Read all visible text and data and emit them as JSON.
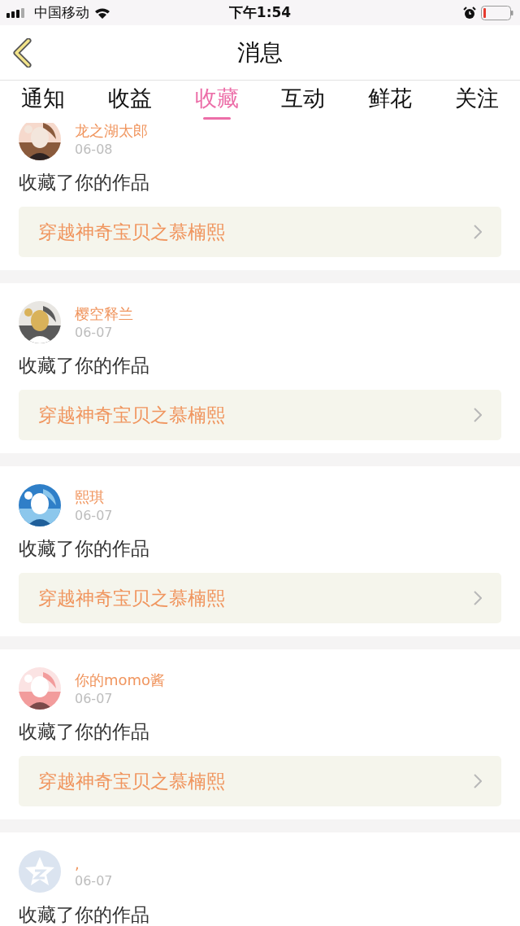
{
  "status_bar": {
    "carrier": "中国移动",
    "time": "下午1:54"
  },
  "nav": {
    "title": "消息"
  },
  "tabs": [
    {
      "label": "通知",
      "selected": false
    },
    {
      "label": "收益",
      "selected": false
    },
    {
      "label": "收藏",
      "selected": true
    },
    {
      "label": "互动",
      "selected": false
    },
    {
      "label": "鲜花",
      "selected": false
    },
    {
      "label": "关注",
      "selected": false
    }
  ],
  "items": [
    {
      "user": "龙之湖太郎",
      "date": "06-08",
      "action": "收藏了你的作品",
      "work": "穿越神奇宝贝之慕楠熙"
    },
    {
      "user": "樱空释兰",
      "date": "06-07",
      "action": "收藏了你的作品",
      "work": "穿越神奇宝贝之慕楠熙"
    },
    {
      "user": "熙琪",
      "date": "06-07",
      "action": "收藏了你的作品",
      "work": "穿越神奇宝贝之慕楠熙"
    },
    {
      "user": "你的momo酱",
      "date": "06-07",
      "action": "收藏了你的作品",
      "work": "穿越神奇宝贝之慕楠熙"
    },
    {
      "user": ",",
      "date": "06-07",
      "action": "收藏了你的作品",
      "avatar": {
        "kind": "default"
      }
    }
  ]
}
